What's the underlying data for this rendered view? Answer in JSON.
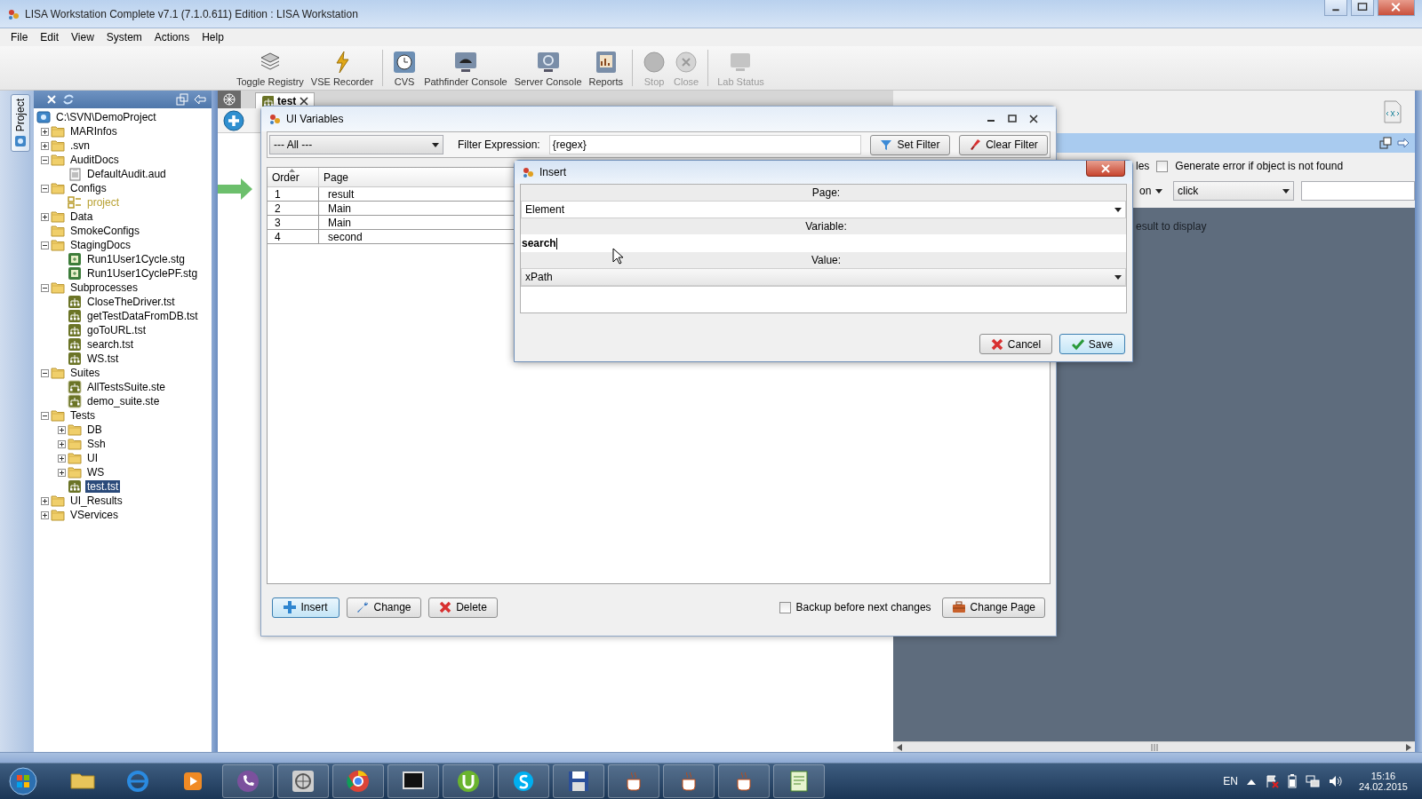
{
  "window": {
    "title": "LISA Workstation Complete v7.1 (7.1.0.611) Edition : LISA Workstation"
  },
  "menu": [
    "File",
    "Edit",
    "View",
    "System",
    "Actions",
    "Help"
  ],
  "toolbar": [
    {
      "label": "Toggle Registry",
      "disabled": false
    },
    {
      "label": "VSE Recorder",
      "disabled": false
    },
    {
      "label": "CVS",
      "disabled": false
    },
    {
      "label": "Pathfinder Console",
      "disabled": false
    },
    {
      "label": "Server Console",
      "disabled": false
    },
    {
      "label": "Reports",
      "disabled": false
    },
    {
      "label": "Stop",
      "disabled": true
    },
    {
      "label": "Close",
      "disabled": true
    },
    {
      "label": "Lab Status",
      "disabled": true
    }
  ],
  "side_tab": {
    "label": "Project"
  },
  "tree": {
    "items": [
      {
        "label": "C:\\SVN\\DemoProject",
        "kind": "root",
        "selected": false,
        "children": [
          {
            "label": "MARInfos",
            "kind": "folder",
            "expanded": false,
            "selected": false
          },
          {
            "label": ".svn",
            "kind": "folder",
            "expanded": false,
            "selected": false
          },
          {
            "label": "AuditDocs",
            "kind": "folder",
            "expanded": true,
            "selected": false,
            "children": [
              {
                "label": "DefaultAudit.aud",
                "kind": "audit",
                "selected": false
              }
            ]
          },
          {
            "label": "Configs",
            "kind": "folder",
            "expanded": true,
            "selected": false,
            "children": [
              {
                "label": "project",
                "kind": "config",
                "selected": false
              }
            ]
          },
          {
            "label": "Data",
            "kind": "folder",
            "expanded": false,
            "selected": false
          },
          {
            "label": "SmokeConfigs",
            "kind": "folder",
            "selected": false
          },
          {
            "label": "StagingDocs",
            "kind": "folder",
            "expanded": true,
            "selected": false,
            "children": [
              {
                "label": "Run1User1Cycle.stg",
                "kind": "staging",
                "selected": false
              },
              {
                "label": "Run1User1CyclePF.stg",
                "kind": "staging",
                "selected": false
              }
            ]
          },
          {
            "label": "Subprocesses",
            "kind": "folder",
            "expanded": true,
            "selected": false,
            "children": [
              {
                "label": "CloseTheDriver.tst",
                "kind": "test",
                "selected": false
              },
              {
                "label": "getTestDataFromDB.tst",
                "kind": "test",
                "selected": false
              },
              {
                "label": "goToURL.tst",
                "kind": "test",
                "selected": false
              },
              {
                "label": "search.tst",
                "kind": "test",
                "selected": false
              },
              {
                "label": "WS.tst",
                "kind": "test",
                "selected": false
              }
            ]
          },
          {
            "label": "Suites",
            "kind": "folder",
            "expanded": true,
            "selected": false,
            "children": [
              {
                "label": "AllTestsSuite.ste",
                "kind": "suite",
                "selected": false
              },
              {
                "label": "demo_suite.ste",
                "kind": "suite",
                "selected": false
              }
            ]
          },
          {
            "label": "Tests",
            "kind": "folder",
            "expanded": true,
            "selected": false,
            "children": [
              {
                "label": "DB",
                "kind": "folder",
                "expanded": false,
                "selected": false
              },
              {
                "label": "Ssh",
                "kind": "folder",
                "expanded": false,
                "selected": false
              },
              {
                "label": "UI",
                "kind": "folder",
                "expanded": false,
                "selected": false
              },
              {
                "label": "WS",
                "kind": "folder",
                "expanded": false,
                "selected": false
              },
              {
                "label": "test.tst",
                "kind": "test",
                "selected": true
              }
            ]
          },
          {
            "label": "UI_Results",
            "kind": "folder",
            "expanded": false,
            "selected": false
          },
          {
            "label": "VServices",
            "kind": "folder",
            "expanded": false,
            "selected": false
          }
        ]
      }
    ]
  },
  "editor_tab": {
    "label": "test"
  },
  "right_panel": {
    "cut_label": "les",
    "checkbox": {
      "label": "Generate error if object is not found",
      "checked": false
    },
    "dropdown_1": "on",
    "dropdown_2": "click",
    "result_text": "esult to display"
  },
  "ui_variables": {
    "title": "UI Variables",
    "filter_dropdown": "--- All ---",
    "filter_label": "Filter Expression:",
    "filter_value": "{regex}",
    "filter_buttons": [
      "Set Filter",
      "Clear Filter"
    ],
    "table": {
      "columns": [
        "Order",
        "Page"
      ],
      "rows": [
        [
          "1",
          "result"
        ],
        [
          "2",
          "Main"
        ],
        [
          "3",
          "Main"
        ],
        [
          "4",
          "second"
        ]
      ]
    },
    "actions": [
      "Insert",
      "Change",
      "Delete"
    ],
    "backup": {
      "label": "Backup before next changes",
      "checked": false
    },
    "change_page": "Change Page"
  },
  "insert_dialog": {
    "title": "Insert",
    "fields": [
      {
        "label": "Page:",
        "kind": "dropdown",
        "value": "Element"
      },
      {
        "label": "Variable:",
        "kind": "text",
        "value": "search"
      },
      {
        "label": "Value:",
        "kind": "dropdown",
        "value": "xPath"
      }
    ],
    "buttons": [
      "Cancel",
      "Save"
    ]
  },
  "taskbar": {
    "language": "EN",
    "time": "15:16",
    "date": "24.02.2015"
  }
}
